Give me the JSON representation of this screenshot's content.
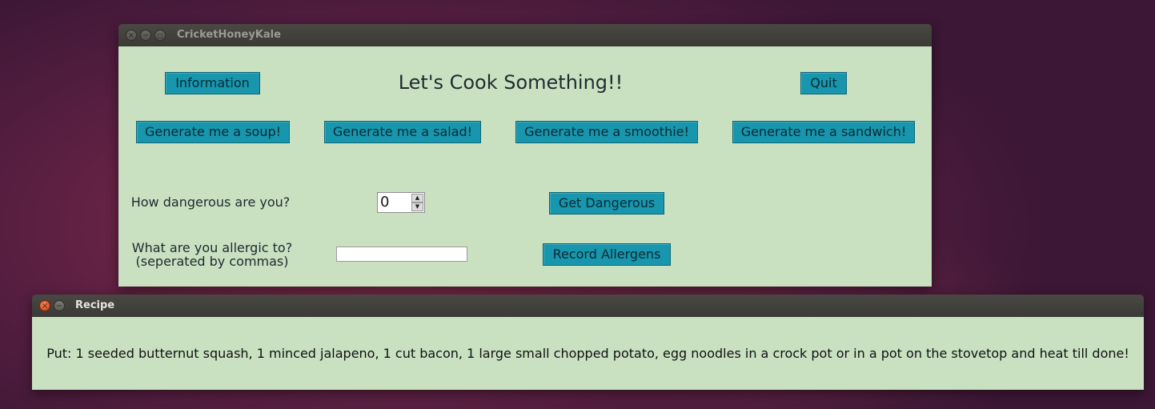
{
  "main_window": {
    "title": "CricketHoneyKale",
    "heading": "Let's Cook Something!!",
    "buttons": {
      "information": "Information",
      "quit": "Quit",
      "soup": "Generate me a soup!",
      "salad": "Generate me a salad!",
      "smoothie": "Generate me a smoothie!",
      "sandwich": "Generate me a sandwich!",
      "get_dangerous": "Get Dangerous",
      "record_allergens": "Record Allergens"
    },
    "danger": {
      "label": "How dangerous are you?",
      "value": "0"
    },
    "allergy": {
      "label_line1": "What are you allergic to?",
      "label_line2": "(seperated by commas)",
      "value": ""
    }
  },
  "recipe_window": {
    "title": "Recipe",
    "text": "Put: 1 seeded butternut squash, 1 minced jalapeno, 1 cut bacon, 1 large small chopped potato,  egg noodles in a crock pot or in a pot on the stovetop and heat till done!"
  },
  "colors": {
    "window_background": "#c9e0c1",
    "button_background": "#1796ad",
    "titlebar": "#3d3c38"
  },
  "icons": {
    "close": "close-icon",
    "minimize": "minimize-icon",
    "maximize": "maximize-icon",
    "spin_up": "arrow-up-icon",
    "spin_down": "arrow-down-icon"
  }
}
